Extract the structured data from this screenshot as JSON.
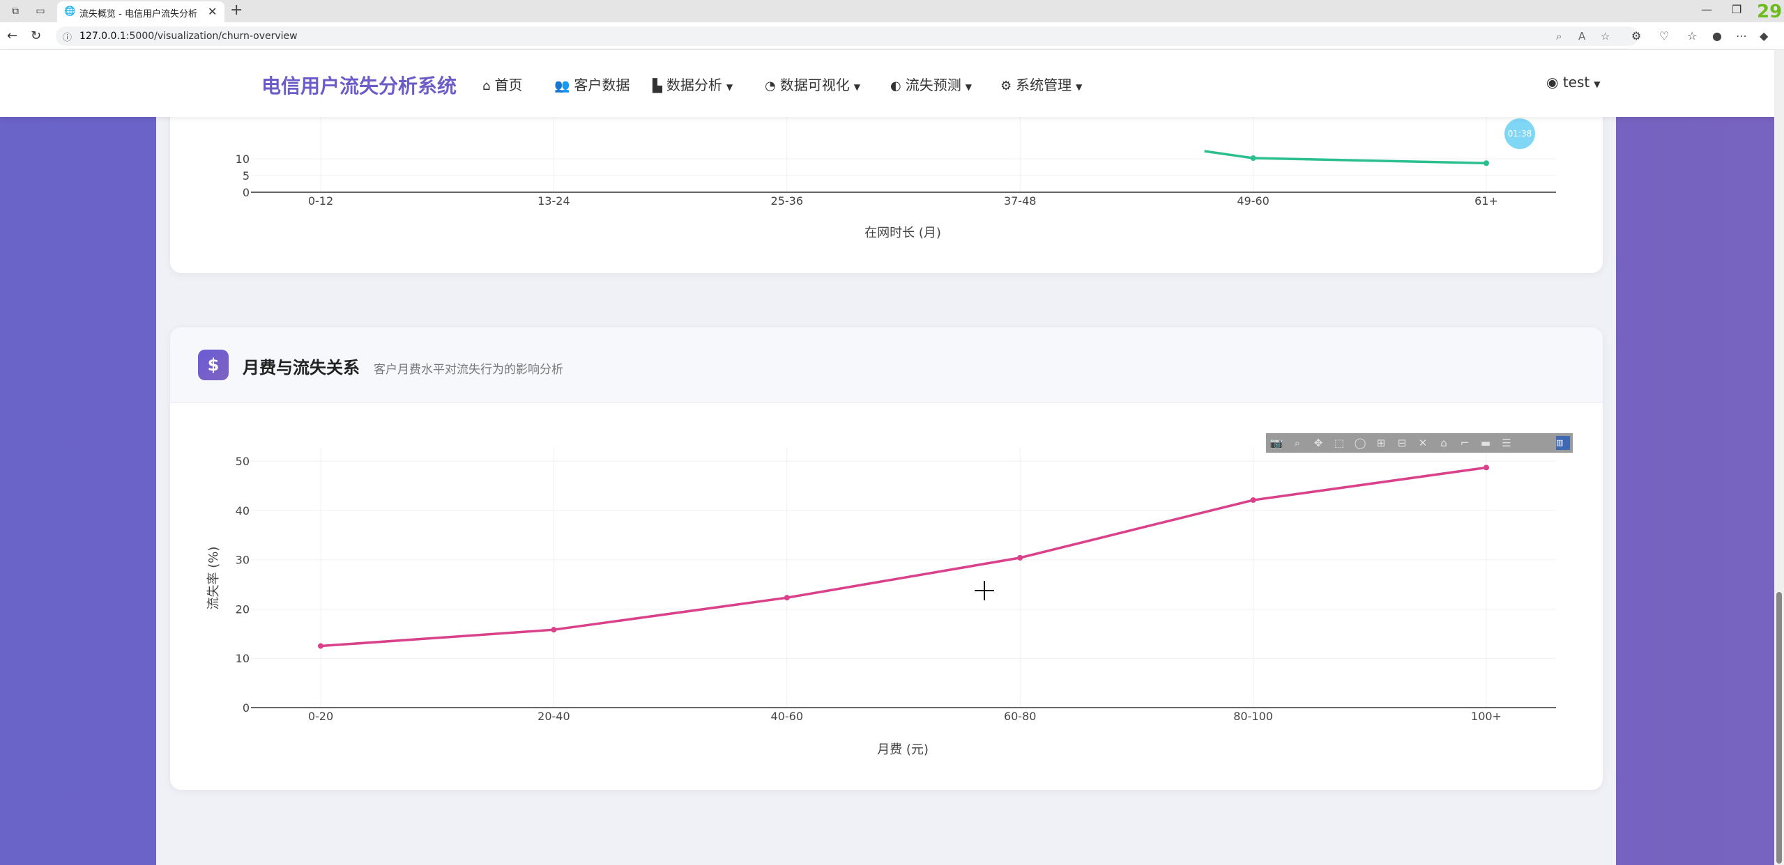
{
  "browser": {
    "tab_title": "流失概览 - 电信用户流失分析系统",
    "url_host": "127.0.0.1",
    "url_rest": ":5000/visualization/churn-overview",
    "badge": "29"
  },
  "navbar": {
    "brand": "电信用户流失分析系统",
    "items": [
      {
        "label": "首页",
        "icon": "home-icon"
      },
      {
        "label": "客户数据",
        "icon": "users-icon"
      },
      {
        "label": "数据分析",
        "icon": "bar-chart-icon",
        "dropdown": true
      },
      {
        "label": "数据可视化",
        "icon": "pie-chart-icon",
        "dropdown": true
      },
      {
        "label": "流失预测",
        "icon": "brain-icon",
        "dropdown": true
      },
      {
        "label": "系统管理",
        "icon": "gear-icon",
        "dropdown": true
      }
    ],
    "user": "test"
  },
  "card1": {
    "xlabel": "在网时长 (月)",
    "timer": "01:38",
    "chart_data": {
      "type": "line",
      "categories": [
        "0-12",
        "13-24",
        "25-36",
        "37-48",
        "49-60",
        "61+"
      ],
      "visible_values": {
        "49-60": 10.2,
        "61+": 8.7
      },
      "y_ticks": [
        0,
        5,
        10
      ],
      "color": "#2bbf8f"
    }
  },
  "card2": {
    "title": "月费与流失关系",
    "subtitle": "客户月费水平对流失行为的影响分析",
    "icon": "dollar-icon",
    "chart_data": {
      "type": "line",
      "categories": [
        "0-20",
        "20-40",
        "40-60",
        "60-80",
        "80-100",
        "100+"
      ],
      "values": [
        12.5,
        15.8,
        22.3,
        30.4,
        42.1,
        48.7
      ],
      "xlabel": "月费 (元)",
      "ylabel": "流失率 (%)",
      "ylim": [
        0,
        52
      ],
      "y_ticks": [
        0,
        10,
        20,
        30,
        40,
        50
      ],
      "color": "#d9418a"
    }
  }
}
